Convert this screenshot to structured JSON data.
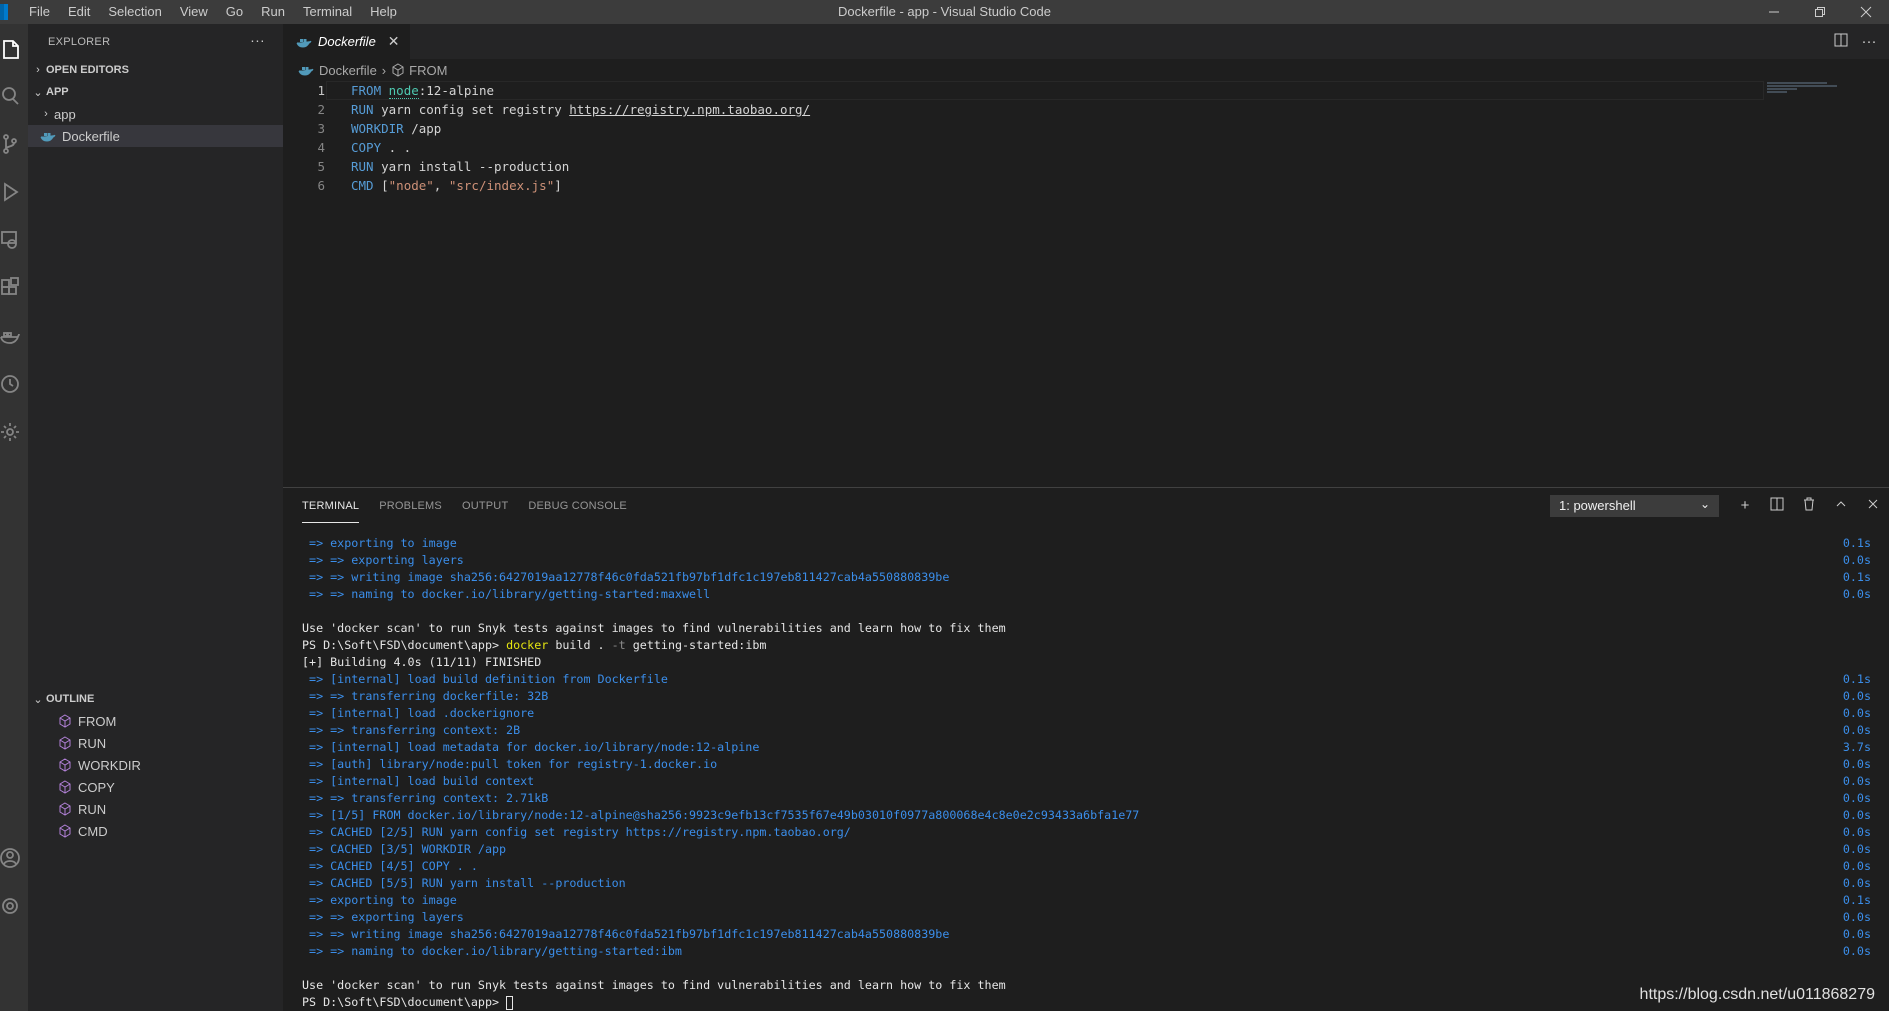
{
  "window": {
    "title": "Dockerfile - app - Visual Studio Code",
    "menu": [
      "File",
      "Edit",
      "Selection",
      "View",
      "Go",
      "Run",
      "Terminal",
      "Help"
    ]
  },
  "sidebar": {
    "header": "EXPLORER",
    "open_editors": "OPEN EDITORS",
    "folder": "APP",
    "tree": [
      {
        "label": "app",
        "type": "folder"
      },
      {
        "label": "Dockerfile",
        "type": "file",
        "selected": true
      }
    ],
    "outline_header": "OUTLINE",
    "outline": [
      "FROM",
      "RUN",
      "WORKDIR",
      "COPY",
      "RUN",
      "CMD"
    ]
  },
  "editor": {
    "tab_label": "Dockerfile",
    "breadcrumb": {
      "file": "Dockerfile",
      "symbol": "FROM"
    },
    "lines": [
      {
        "n": "1",
        "kw": "FROM",
        "a": "node",
        "b": ":12-alpine"
      },
      {
        "n": "2",
        "kw": "RUN",
        "a": " yarn config set registry ",
        "url": "https://registry.npm.taobao.org/"
      },
      {
        "n": "3",
        "kw": "WORKDIR",
        "a": " /app"
      },
      {
        "n": "4",
        "kw": "COPY",
        "a": " . ."
      },
      {
        "n": "5",
        "kw": "RUN",
        "a": " yarn install --production"
      },
      {
        "n": "6",
        "kw": "CMD",
        "p1": " [",
        "s1": "\"node\"",
        "p2": ", ",
        "s2": "\"src/index.js\"",
        "p3": "]"
      }
    ]
  },
  "panel": {
    "tabs": [
      "TERMINAL",
      "PROBLEMS",
      "OUTPUT",
      "DEBUG CONSOLE"
    ],
    "terminal_select": "1: powershell",
    "terminal_lines": [
      {
        "t": " => exporting to image",
        "time": "0.1s",
        "c": "blue"
      },
      {
        "t": " => => exporting layers",
        "time": "0.0s",
        "c": "blue"
      },
      {
        "t": " => => writing image sha256:6427019aa12778f46c0fda521fb97bf1dfc1c197eb811427cab4a550880839be",
        "time": "0.1s",
        "c": "blue"
      },
      {
        "t": " => => naming to docker.io/library/getting-started:maxwell",
        "time": "0.0s",
        "c": "blue"
      },
      {
        "t": "",
        "time": "",
        "c": "white"
      },
      {
        "t": "Use 'docker scan' to run Snyk tests against images to find vulnerabilities and learn how to fix them",
        "time": "",
        "c": "white"
      },
      {
        "prompt": "PS D:\\Soft\\FSD\\document\\app> ",
        "cmd": "docker",
        "rest1": " build . ",
        "flag": "-t",
        "rest2": " getting-started:ibm",
        "c": "white"
      },
      {
        "t": "[+] Building 4.0s (11/11) FINISHED",
        "time": "",
        "c": "white"
      },
      {
        "t": " => [internal] load build definition from Dockerfile",
        "time": "0.1s",
        "c": "blue"
      },
      {
        "t": " => => transferring dockerfile: 32B",
        "time": "0.0s",
        "c": "blue"
      },
      {
        "t": " => [internal] load .dockerignore",
        "time": "0.0s",
        "c": "blue"
      },
      {
        "t": " => => transferring context: 2B",
        "time": "0.0s",
        "c": "blue"
      },
      {
        "t": " => [internal] load metadata for docker.io/library/node:12-alpine",
        "time": "3.7s",
        "c": "blue"
      },
      {
        "t": " => [auth] library/node:pull token for registry-1.docker.io",
        "time": "0.0s",
        "c": "blue"
      },
      {
        "t": " => [internal] load build context",
        "time": "0.0s",
        "c": "blue"
      },
      {
        "t": " => => transferring context: 2.71kB",
        "time": "0.0s",
        "c": "blue"
      },
      {
        "t": " => [1/5] FROM docker.io/library/node:12-alpine@sha256:9923c9efb13cf7535f67e49b03010f0977a800068e4c8e0e2c93433a6bfa1e77",
        "time": "0.0s",
        "c": "blue"
      },
      {
        "t": " => CACHED [2/5] RUN yarn config set registry https://registry.npm.taobao.org/",
        "time": "0.0s",
        "c": "blue"
      },
      {
        "t": " => CACHED [3/5] WORKDIR /app",
        "time": "0.0s",
        "c": "blue"
      },
      {
        "t": " => CACHED [4/5] COPY . .",
        "time": "0.0s",
        "c": "blue"
      },
      {
        "t": " => CACHED [5/5] RUN yarn install --production",
        "time": "0.0s",
        "c": "blue"
      },
      {
        "t": " => exporting to image",
        "time": "0.1s",
        "c": "blue"
      },
      {
        "t": " => => exporting layers",
        "time": "0.0s",
        "c": "blue"
      },
      {
        "t": " => => writing image sha256:6427019aa12778f46c0fda521fb97bf1dfc1c197eb811427cab4a550880839be",
        "time": "0.0s",
        "c": "blue"
      },
      {
        "t": " => => naming to docker.io/library/getting-started:ibm",
        "time": "0.0s",
        "c": "blue"
      },
      {
        "t": "",
        "time": "",
        "c": "white"
      },
      {
        "t": "Use 'docker scan' to run Snyk tests against images to find vulnerabilities and learn how to fix them",
        "time": "",
        "c": "white"
      },
      {
        "t": "PS D:\\Soft\\FSD\\document\\app> ",
        "time": "",
        "c": "white",
        "cursor": true
      }
    ]
  },
  "watermark": "https://blog.csdn.net/u011868279",
  "colors": {
    "keyword": "#569cd6",
    "image": "#4ec9b0",
    "string": "#ce9178",
    "terminal_blue": "#3b8eea",
    "command": "#e5e510"
  }
}
